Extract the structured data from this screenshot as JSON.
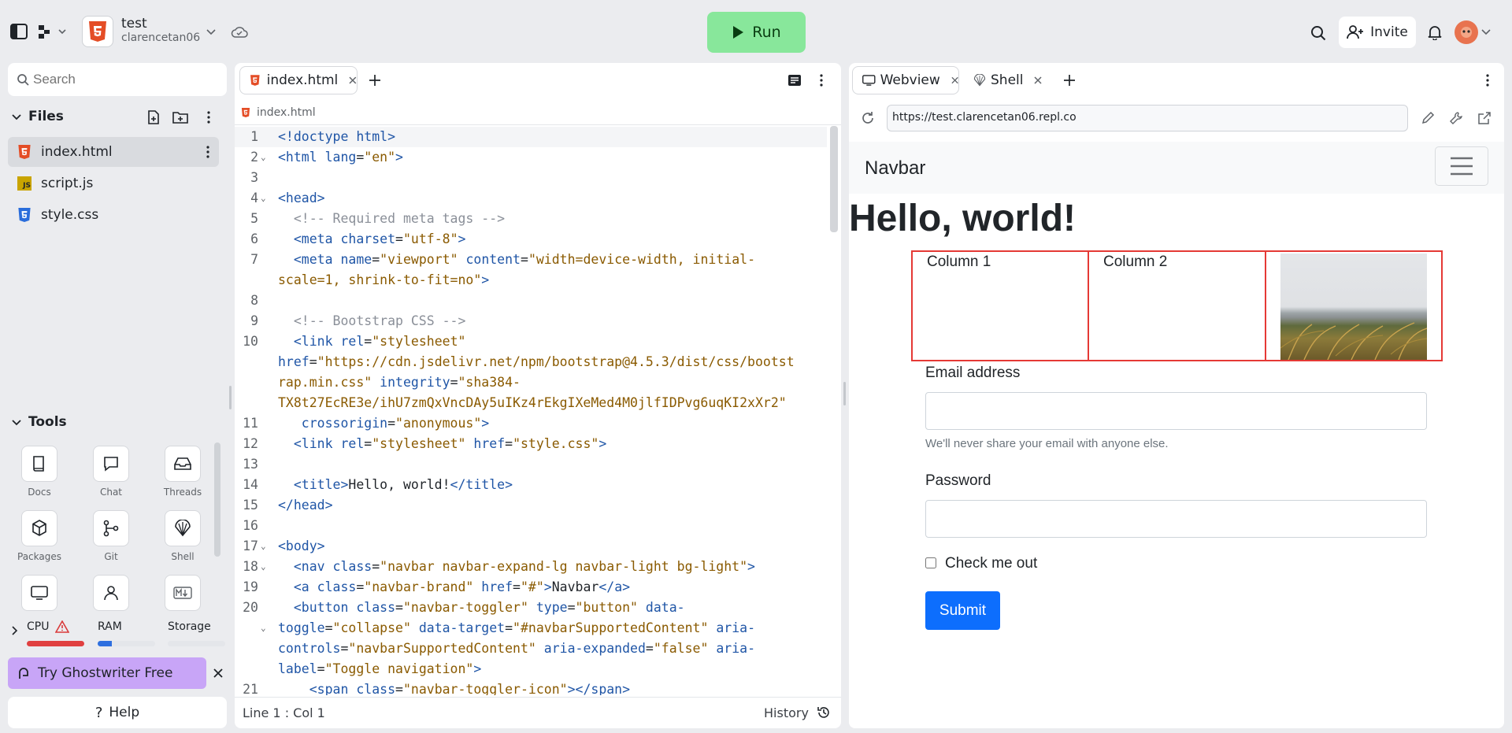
{
  "top": {
    "project_name": "test",
    "owner": "clarencetan06",
    "run_label": "Run",
    "invite_label": "Invite"
  },
  "sidebar": {
    "search_placeholder": "Search",
    "files_label": "Files",
    "files": [
      {
        "name": "index.html",
        "type": "html"
      },
      {
        "name": "script.js",
        "type": "js"
      },
      {
        "name": "style.css",
        "type": "css"
      }
    ],
    "tools_label": "Tools",
    "tools": [
      {
        "label": "Docs",
        "icon": "book-icon"
      },
      {
        "label": "Chat",
        "icon": "chat-icon"
      },
      {
        "label": "Threads",
        "icon": "inbox-icon"
      },
      {
        "label": "Packages",
        "icon": "cube-icon"
      },
      {
        "label": "Git",
        "icon": "git-icon"
      },
      {
        "label": "Shell",
        "icon": "shell-icon"
      }
    ],
    "resources": {
      "cpu": "CPU",
      "ram": "RAM",
      "storage": "Storage",
      "cpu_level": 1.0,
      "ram_level": 0.25,
      "storage_level": 0.0
    },
    "ghostwriter": "Try Ghostwriter Free",
    "help": "Help"
  },
  "editor": {
    "tab_label": "index.html",
    "breadcrumb": "index.html",
    "status_position": "Line 1 : Col 1",
    "history_label": "History",
    "lines": [
      {
        "n": "1",
        "parts": [
          [
            "tag",
            "<!doctype html>"
          ]
        ]
      },
      {
        "n": "2",
        "parts": [
          [
            "tag",
            "<html "
          ],
          [
            "attr",
            "lang"
          ],
          [
            "txt",
            "="
          ],
          [
            "str",
            "\"en\""
          ],
          [
            "tag",
            ">"
          ]
        ],
        "fold": true
      },
      {
        "n": "3",
        "parts": []
      },
      {
        "n": "4",
        "parts": [
          [
            "tag",
            "<head>"
          ]
        ],
        "fold": true
      },
      {
        "n": "5",
        "parts": [
          [
            "cmt",
            "  <!-- Required meta tags -->"
          ]
        ]
      },
      {
        "n": "6",
        "parts": [
          [
            "tag",
            "  <meta "
          ],
          [
            "attr",
            "charset"
          ],
          [
            "txt",
            "="
          ],
          [
            "str",
            "\"utf-8\""
          ],
          [
            "tag",
            ">"
          ]
        ]
      },
      {
        "n": "7",
        "parts": [
          [
            "tag",
            "  <meta "
          ],
          [
            "attr",
            "name"
          ],
          [
            "txt",
            "="
          ],
          [
            "str",
            "\"viewport\""
          ],
          [
            "attr",
            " content"
          ],
          [
            "txt",
            "="
          ],
          [
            "str",
            "\"width=device-width, initial-"
          ]
        ]
      },
      {
        "n": "",
        "parts": [
          [
            "str",
            "scale=1, shrink-to-fit=no\""
          ],
          [
            "tag",
            ">"
          ]
        ]
      },
      {
        "n": "8",
        "parts": []
      },
      {
        "n": "9",
        "parts": [
          [
            "cmt",
            "  <!-- Bootstrap CSS -->"
          ]
        ]
      },
      {
        "n": "10",
        "parts": [
          [
            "tag",
            "  <link "
          ],
          [
            "attr",
            "rel"
          ],
          [
            "txt",
            "="
          ],
          [
            "str",
            "\"stylesheet\""
          ]
        ]
      },
      {
        "n": "",
        "parts": [
          [
            "attr",
            "href"
          ],
          [
            "txt",
            "="
          ],
          [
            "str",
            "\"https://cdn.jsdelivr.net/npm/bootstrap@4.5.3/dist/css/bootst"
          ]
        ]
      },
      {
        "n": "",
        "parts": [
          [
            "str",
            "rap.min.css\""
          ],
          [
            "attr",
            " integrity"
          ],
          [
            "txt",
            "="
          ],
          [
            "str",
            "\"sha384-"
          ]
        ]
      },
      {
        "n": "",
        "parts": [
          [
            "str",
            "TX8t27EcRE3e/ihU7zmQxVncDAy5uIKz4rEkgIXeMed4M0jlfIDPvg6uqKI2xXr2\""
          ]
        ]
      },
      {
        "n": "11",
        "parts": [
          [
            "attr",
            "   crossorigin"
          ],
          [
            "txt",
            "="
          ],
          [
            "str",
            "\"anonymous\""
          ],
          [
            "tag",
            ">"
          ]
        ]
      },
      {
        "n": "12",
        "parts": [
          [
            "tag",
            "  <link "
          ],
          [
            "attr",
            "rel"
          ],
          [
            "txt",
            "="
          ],
          [
            "str",
            "\"stylesheet\""
          ],
          [
            "attr",
            " href"
          ],
          [
            "txt",
            "="
          ],
          [
            "str",
            "\"style.css\""
          ],
          [
            "tag",
            ">"
          ]
        ]
      },
      {
        "n": "13",
        "parts": []
      },
      {
        "n": "14",
        "parts": [
          [
            "tag",
            "  <title>"
          ],
          [
            "txt",
            "Hello, world!"
          ],
          [
            "tag",
            "</title>"
          ]
        ]
      },
      {
        "n": "15",
        "parts": [
          [
            "tag",
            "</head>"
          ]
        ]
      },
      {
        "n": "16",
        "parts": []
      },
      {
        "n": "17",
        "parts": [
          [
            "tag",
            "<body>"
          ]
        ],
        "fold": true
      },
      {
        "n": "18",
        "parts": [
          [
            "tag",
            "  <nav "
          ],
          [
            "attr",
            "class"
          ],
          [
            "txt",
            "="
          ],
          [
            "str",
            "\"navbar navbar-expand-lg navbar-light bg-light\""
          ],
          [
            "tag",
            ">"
          ]
        ],
        "fold": true
      },
      {
        "n": "19",
        "parts": [
          [
            "tag",
            "  <a "
          ],
          [
            "attr",
            "class"
          ],
          [
            "txt",
            "="
          ],
          [
            "str",
            "\"navbar-brand\""
          ],
          [
            "attr",
            " href"
          ],
          [
            "txt",
            "="
          ],
          [
            "str",
            "\"#\""
          ],
          [
            "tag",
            ">"
          ],
          [
            "txt",
            "Navbar"
          ],
          [
            "tag",
            "</a>"
          ]
        ]
      },
      {
        "n": "20",
        "parts": [
          [
            "tag",
            "  <button "
          ],
          [
            "attr",
            "class"
          ],
          [
            "txt",
            "="
          ],
          [
            "str",
            "\"navbar-toggler\""
          ],
          [
            "attr",
            " type"
          ],
          [
            "txt",
            "="
          ],
          [
            "str",
            "\"button\""
          ],
          [
            "attr",
            " data-"
          ]
        ]
      },
      {
        "n": "",
        "parts": [
          [
            "attr",
            "toggle"
          ],
          [
            "txt",
            "="
          ],
          [
            "str",
            "\"collapse\""
          ],
          [
            "attr",
            " data-target"
          ],
          [
            "txt",
            "="
          ],
          [
            "str",
            "\"#navbarSupportedContent\""
          ],
          [
            "attr",
            " aria-"
          ]
        ],
        "fold": true
      },
      {
        "n": "",
        "parts": [
          [
            "attr",
            "controls"
          ],
          [
            "txt",
            "="
          ],
          [
            "str",
            "\"navbarSupportedContent\""
          ],
          [
            "attr",
            " aria-expanded"
          ],
          [
            "txt",
            "="
          ],
          [
            "str",
            "\"false\""
          ],
          [
            "attr",
            " aria-"
          ]
        ]
      },
      {
        "n": "",
        "parts": [
          [
            "attr",
            "label"
          ],
          [
            "txt",
            "="
          ],
          [
            "str",
            "\"Toggle navigation\""
          ],
          [
            "tag",
            ">"
          ]
        ]
      },
      {
        "n": "21",
        "parts": [
          [
            "tag",
            "    <span "
          ],
          [
            "attr",
            "class"
          ],
          [
            "txt",
            "="
          ],
          [
            "str",
            "\"navbar-toggler-icon\""
          ],
          [
            "tag",
            "></span>"
          ]
        ]
      }
    ]
  },
  "webview": {
    "tab_webview": "Webview",
    "tab_shell": "Shell",
    "url": "https://test.clarencetan06.repl.co",
    "brand": "Navbar",
    "heading": "Hello, world!",
    "col1": "Column 1",
    "col2": "Column 2",
    "email_label": "Email address",
    "email_help": "We'll never share your email with anyone else.",
    "password_label": "Password",
    "check_label": "Check me out",
    "submit_label": "Submit"
  }
}
